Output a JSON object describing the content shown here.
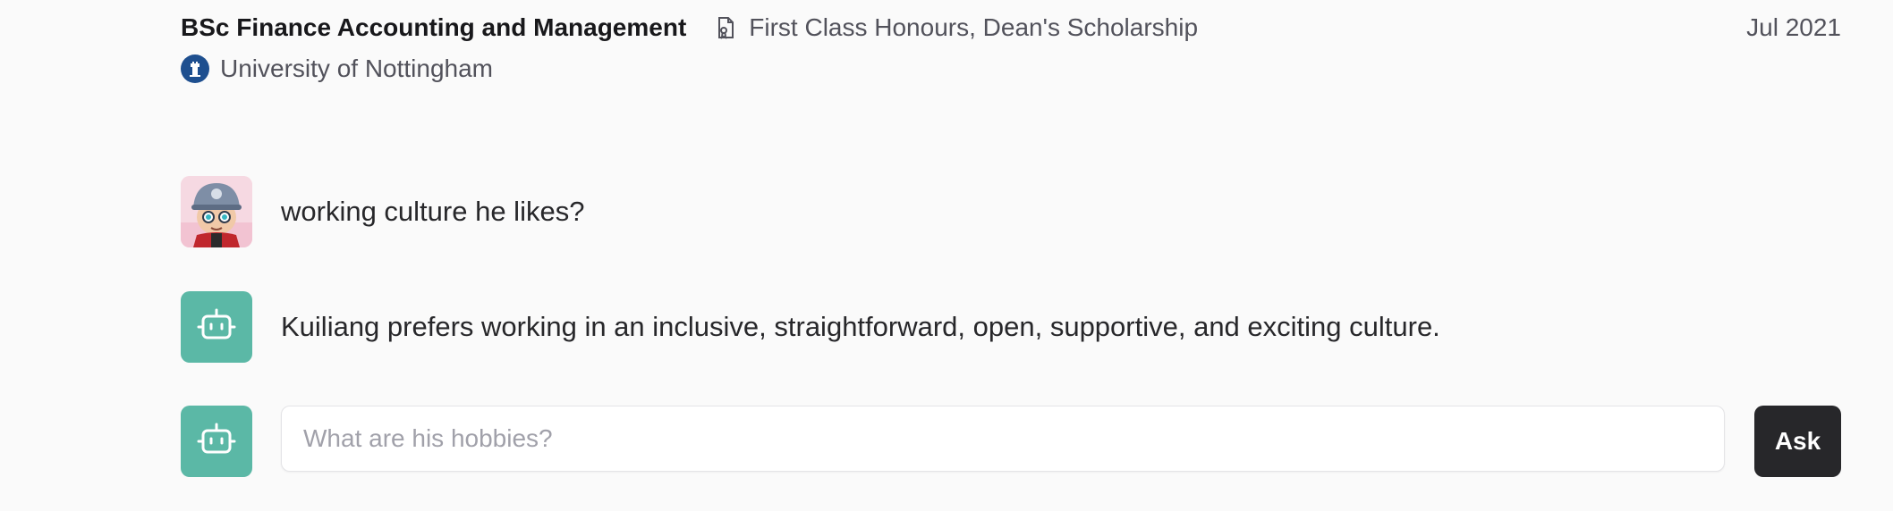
{
  "education": {
    "degree": "BSc Finance Accounting and Management",
    "award_icon": "certificate-icon",
    "award": "First Class Honours, Dean's Scholarship",
    "date": "Jul 2021",
    "university_logo": "university-of-nottingham-logo",
    "university": "University of Nottingham"
  },
  "chat": {
    "user_avatar": "cartoon-user-avatar",
    "bot_icon": "robot-icon",
    "question": "working culture he likes?",
    "answer": "Kuiliang prefers working in an inclusive, straightforward, open, supportive, and exciting culture."
  },
  "ask": {
    "input_value": "",
    "placeholder": "What are his hobbies?",
    "button_label": "Ask"
  },
  "colors": {
    "background": "#fafafa",
    "bot_avatar": "#5bb8a6",
    "ask_button": "#27272a",
    "university_logo": "#1e4f8f"
  }
}
